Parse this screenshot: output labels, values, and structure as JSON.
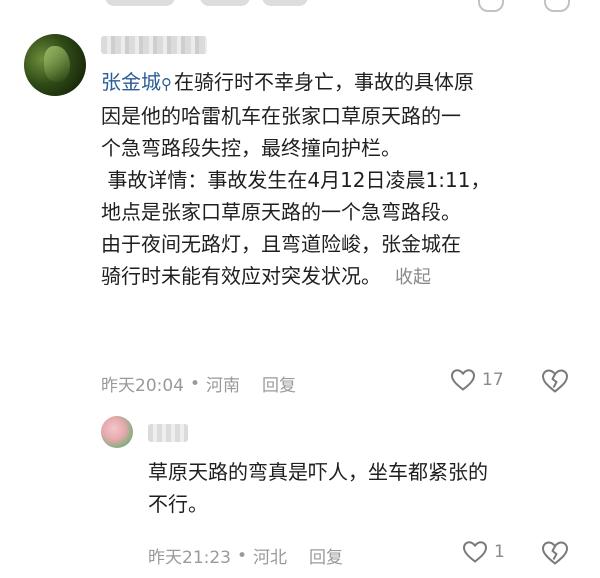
{
  "comment": {
    "mention": "张金城",
    "lines": [
      "在骑行时不幸身亡，事故的具体原",
      "因是他的哈雷机车在张家口草原天路的一",
      "个急弯路段失控，最终撞向护栏。",
      " 事故详情：事故发生在4月12日凌晨1:11，",
      "地点是张家口草原天路的一个急弯路段。",
      "由于夜间无路灯，且弯道险峻，张金城在",
      "骑行时未能有效应对突发状况。"
    ],
    "collapse_label": "收起",
    "time": "昨天20:04",
    "location": "河南",
    "reply_label": "回复",
    "like_count": "17"
  },
  "reply": {
    "lines": [
      "草原天路的弯真是吓人，坐车都紧张的",
      "不行。"
    ],
    "time": "昨天21:23",
    "location": "河北",
    "reply_label": "回复",
    "like_count": "1"
  },
  "icons": {
    "like": "heart-outline-icon",
    "dislike": "broken-heart-icon",
    "mention_search": "search-icon"
  }
}
